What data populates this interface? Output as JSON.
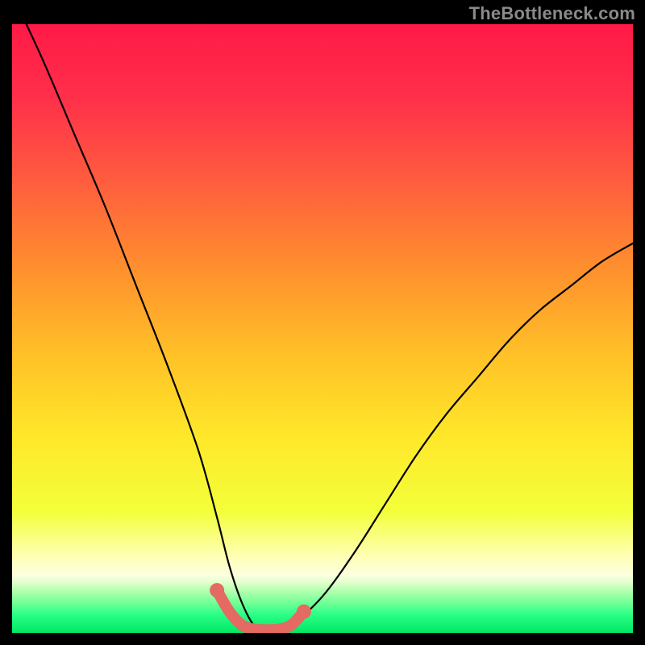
{
  "watermark": "TheBottleneck.com",
  "chart_data": {
    "type": "line",
    "title": "",
    "xlabel": "",
    "ylabel": "",
    "xlim": [
      0,
      100
    ],
    "ylim": [
      0,
      100
    ],
    "series": [
      {
        "name": "bottleneck-curve",
        "x": [
          0,
          5,
          10,
          15,
          20,
          25,
          30,
          33,
          35,
          37,
          39,
          41,
          43,
          45,
          50,
          55,
          60,
          65,
          70,
          75,
          80,
          85,
          90,
          95,
          100
        ],
        "y": [
          105,
          94,
          82,
          70,
          57,
          44,
          30,
          19,
          11,
          5,
          1.2,
          0.5,
          0.5,
          1.2,
          6,
          13,
          21,
          29,
          36,
          42,
          48,
          53,
          57,
          61,
          64
        ]
      },
      {
        "name": "bottom-segment",
        "x": [
          33,
          35,
          37,
          39,
          41,
          43,
          45,
          47
        ],
        "y": [
          7,
          3.5,
          1.3,
          0.6,
          0.5,
          0.6,
          1.3,
          3.5
        ]
      }
    ],
    "gradient_stops": [
      {
        "offset": 0.0,
        "color": "#ff1a47"
      },
      {
        "offset": 0.12,
        "color": "#ff2f4a"
      },
      {
        "offset": 0.25,
        "color": "#ff5a3f"
      },
      {
        "offset": 0.4,
        "color": "#ff8f2e"
      },
      {
        "offset": 0.55,
        "color": "#ffc327"
      },
      {
        "offset": 0.68,
        "color": "#ffe82a"
      },
      {
        "offset": 0.8,
        "color": "#f3ff3a"
      },
      {
        "offset": 0.88,
        "color": "#ffffbe"
      },
      {
        "offset": 0.905,
        "color": "#fbffe0"
      },
      {
        "offset": 0.915,
        "color": "#e7ffd0"
      },
      {
        "offset": 0.93,
        "color": "#b6ffb0"
      },
      {
        "offset": 0.95,
        "color": "#74ff98"
      },
      {
        "offset": 0.97,
        "color": "#2bff86"
      },
      {
        "offset": 1.0,
        "color": "#00e765"
      }
    ]
  }
}
